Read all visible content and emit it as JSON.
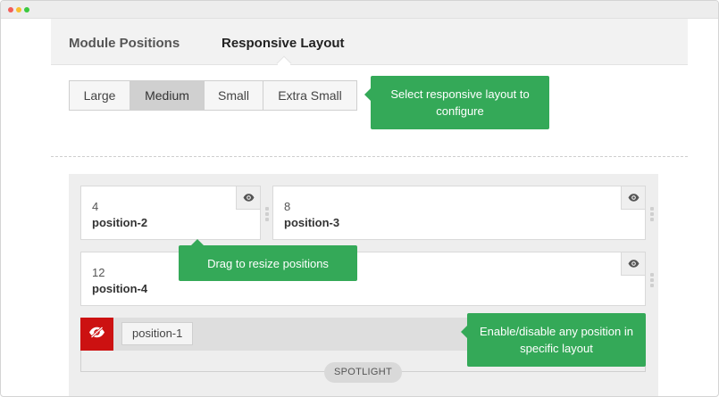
{
  "tabs": [
    {
      "label": "Module Positions",
      "active": false
    },
    {
      "label": "Responsive Layout",
      "active": true
    }
  ],
  "layout_options": [
    {
      "label": "Large",
      "selected": false
    },
    {
      "label": "Medium",
      "selected": true
    },
    {
      "label": "Small",
      "selected": false
    },
    {
      "label": "Extra Small",
      "selected": false
    }
  ],
  "tooltips": {
    "select_layout": "Select responsive layout to configure",
    "drag_resize": "Drag to resize positions",
    "enable_disable": "Enable/disable any position in specific layout"
  },
  "positions": [
    {
      "width": "4",
      "name": "position-2",
      "visible": true
    },
    {
      "width": "8",
      "name": "position-3",
      "visible": true
    },
    {
      "width": "12",
      "name": "position-4",
      "visible": true
    }
  ],
  "disabled_position": {
    "name": "position-1",
    "visible": false
  },
  "block_label": "SPOTLIGHT",
  "icons": {
    "visibility": "eye-icon",
    "hidden": "eye-off-icon"
  },
  "colors": {
    "tooltip": "#34a958",
    "disabled_toggle": "#cc1111",
    "selected_option": "#d0d0d0"
  }
}
